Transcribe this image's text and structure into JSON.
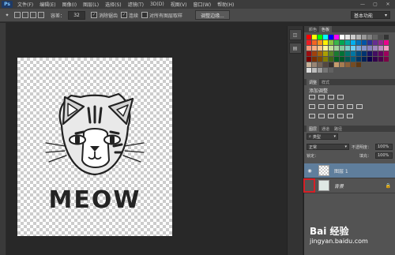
{
  "menubar": {
    "logo": "Ps",
    "items": [
      "文件(F)",
      "编辑(E)",
      "图像(I)",
      "图层(L)",
      "选择(S)",
      "滤镜(T)",
      "3D(D)",
      "视图(V)",
      "窗口(W)",
      "帮助(H)"
    ]
  },
  "options": {
    "tolerance_label": "容差：",
    "tolerance_value": "32",
    "antialias_label": "消除锯齿",
    "contiguous_label": "连续",
    "sample_all_label": "对所有图层取样",
    "refine_edge_label": "调整边缘...",
    "workspace": "基本功能"
  },
  "artwork": {
    "text": "MEOW"
  },
  "panels": {
    "color_tabs": [
      "颜色",
      "色板"
    ],
    "adjust_tabs": [
      "调整",
      "样式"
    ],
    "adjust_title": "添加调整",
    "layers_tabs": [
      "图层",
      "通道",
      "路径"
    ],
    "kind_label": "类型",
    "blend_mode": "正常",
    "opacity_label": "不透明度：",
    "opacity_value": "100%",
    "lock_label": "锁定：",
    "fill_label": "填充：",
    "fill_value": "100%",
    "layers": [
      {
        "name": "图层 1",
        "selected": true
      },
      {
        "name": "背景",
        "selected": false
      }
    ]
  },
  "watermark": {
    "brand": "Bai 经验",
    "url": "jingyan.baidu.com"
  },
  "colors": {
    "highlight": "#d61f26",
    "selected_layer": "#5f7e9c"
  }
}
